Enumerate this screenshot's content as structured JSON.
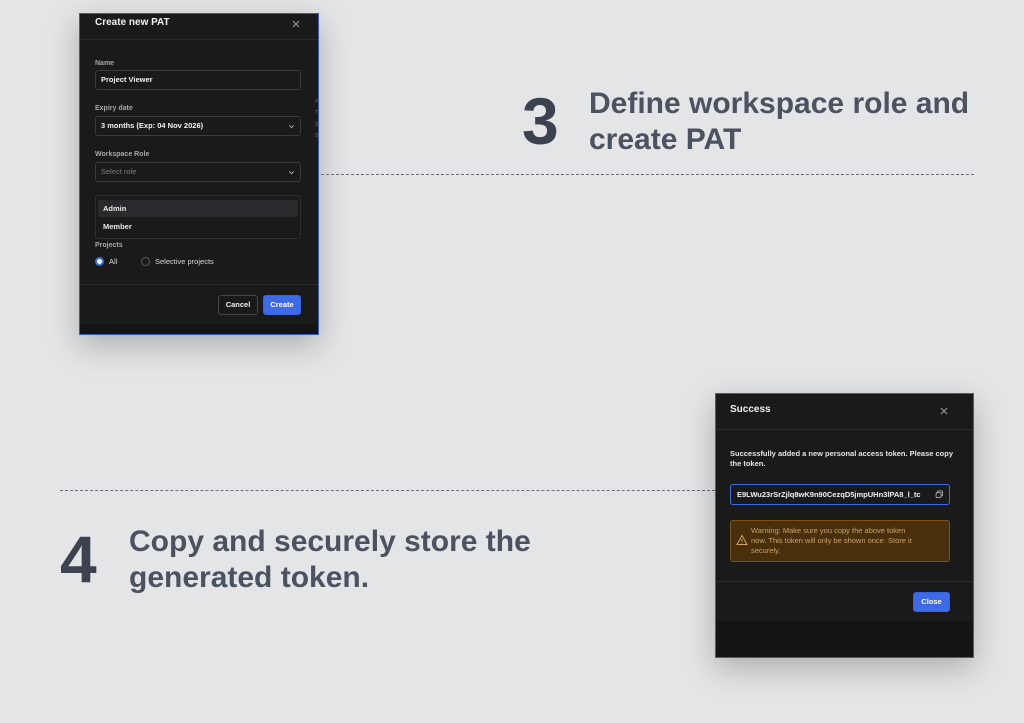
{
  "pat_dialog": {
    "title": "Create new PAT",
    "name_label": "Name",
    "name_value": "Project Viewer",
    "expiry_label": "Expiry date",
    "expiry_value": "3 months (Exp: 04 Nov 2026)",
    "role_label": "Workspace Role",
    "role_placeholder": "Select role",
    "role_options": [
      "Admin",
      "Member"
    ],
    "projects_label": "Projects",
    "project_options": [
      "All",
      "Selective projects"
    ],
    "selected_project_option": "All",
    "cancel_label": "Cancel",
    "create_label": "Create",
    "edge_text": [
      "a",
      "T",
      "S",
      "S"
    ]
  },
  "step3": {
    "number": "3",
    "text_line1": "Define workspace role and",
    "text_line2": "create PAT"
  },
  "step4": {
    "number": "4",
    "text_line1": "Copy and securely store the",
    "text_line2": "generated token."
  },
  "success_dialog": {
    "title": "Success",
    "message": "Successfully added a new personal access token. Please copy the token.",
    "token": "E9LWu23rSrZjlq8wK9n90CezqD5jmpUHn3lPA8_l_tc",
    "warning": "Warning: Make sure you copy the above token now. This token will only be shown once. Store it securely.",
    "close_label": "Close"
  },
  "colors": {
    "page_background": "#e4e5e7",
    "modal_background": "#1a1a1b",
    "modal_border": "#2f5bd6",
    "primary_button": "#3d6ae6",
    "warning_background": "#4a2f0c",
    "heading_text": "#4b5260"
  },
  "icons": {
    "close": "close-icon",
    "chevron": "chevron-down-icon",
    "copy": "copy-icon",
    "warning": "warning-triangle-icon"
  }
}
